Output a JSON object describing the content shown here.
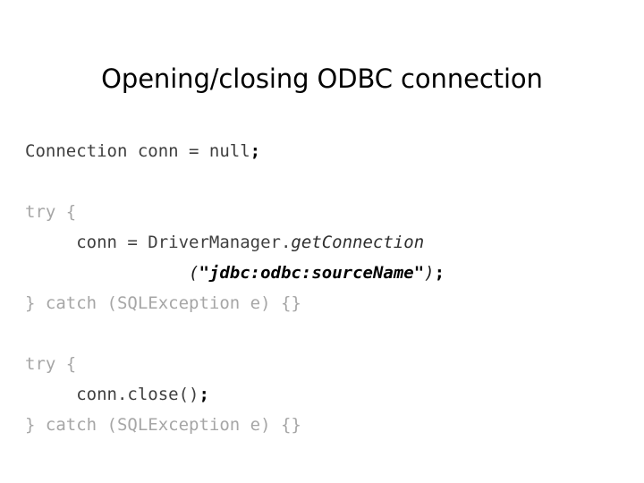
{
  "slide": {
    "title": "Opening/closing ODBC connection",
    "background_color": "#ffffff",
    "title_color": "#000000",
    "keyword_color": "#a6a6a6",
    "identifier_color": "#3f3f3f",
    "string_color": "#000000"
  },
  "code": {
    "lines": [
      {
        "id": "line-declaration",
        "tokens": [
          {
            "style": "ident",
            "text": "Connection conn = null"
          },
          {
            "style": "punct-dark",
            "text": ";"
          }
        ]
      },
      {
        "id": "line-blank-1",
        "tokens": []
      },
      {
        "id": "line-try-open-1",
        "tokens": [
          {
            "style": "keyword",
            "text": "try {"
          }
        ]
      },
      {
        "id": "line-getconnection",
        "tokens": [
          {
            "style": "space",
            "text": "     "
          },
          {
            "style": "ident",
            "text": "conn = DriverManager."
          },
          {
            "style": "method",
            "text": "getConnection"
          }
        ]
      },
      {
        "id": "line-jdbc-url",
        "tokens": [
          {
            "style": "space",
            "text": "                "
          },
          {
            "style": "italic",
            "text": "("
          },
          {
            "style": "string",
            "text": "\"jdbc:odbc:sourceName\""
          },
          {
            "style": "italic",
            "text": ")"
          },
          {
            "style": "punct-dark",
            "text": ";"
          }
        ]
      },
      {
        "id": "line-catch-1",
        "tokens": [
          {
            "style": "keyword",
            "text": "} catch (SQLException e) {}"
          }
        ]
      },
      {
        "id": "line-blank-2",
        "tokens": []
      },
      {
        "id": "line-try-open-2",
        "tokens": [
          {
            "style": "keyword",
            "text": "try {"
          }
        ]
      },
      {
        "id": "line-close",
        "tokens": [
          {
            "style": "space",
            "text": "     "
          },
          {
            "style": "ident",
            "text": "conn.close()"
          },
          {
            "style": "punct-dark",
            "text": ";"
          }
        ]
      },
      {
        "id": "line-catch-2",
        "tokens": [
          {
            "style": "keyword",
            "text": "} catch (SQLException e) {}"
          }
        ]
      }
    ]
  }
}
